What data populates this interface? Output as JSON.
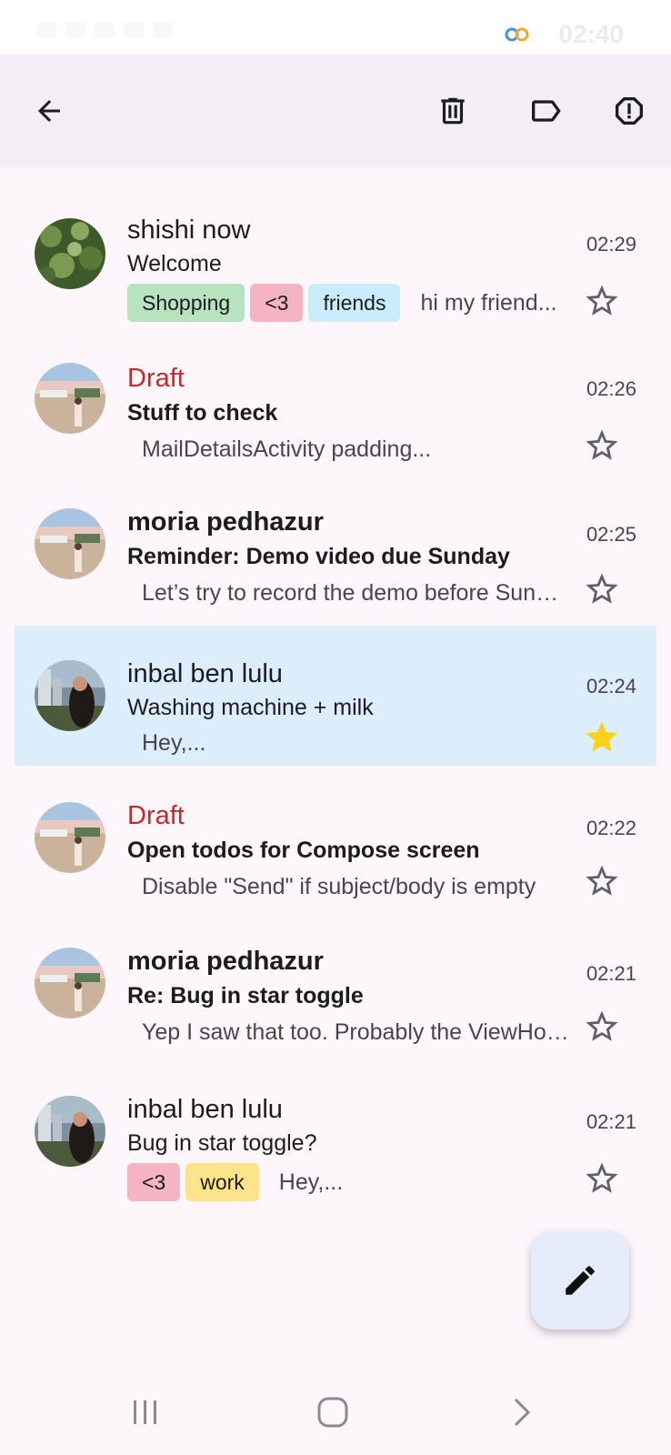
{
  "status_bar": {
    "time": "02:40"
  },
  "app_bar": {
    "back_icon": "arrow-back-icon",
    "delete_icon": "trash-icon",
    "label_icon": "label-icon",
    "report_icon": "report-icon"
  },
  "emails": [
    {
      "sender": "shishi now",
      "subject": "Welcome",
      "preview": "hi my friend...",
      "time": "02:29",
      "starred": false,
      "draft": false,
      "unread": false,
      "tags": [
        {
          "label": "Shopping",
          "color": "#b7e4be"
        },
        {
          "label": "<3",
          "color": "#f4b4c1"
        },
        {
          "label": "friends",
          "color": "#c8ecfa"
        }
      ]
    },
    {
      "sender": "Draft",
      "subject": "Stuff to check",
      "preview": "MailDetailsActivity padding...",
      "time": "02:26",
      "starred": false,
      "draft": true,
      "unread": true,
      "tags": []
    },
    {
      "sender": "moria pedhazur",
      "subject": "Reminder: Demo video due Sunday",
      "preview": "Let’s try to record the demo before Sunday",
      "time": "02:25",
      "starred": false,
      "draft": false,
      "unread": true,
      "tags": []
    },
    {
      "sender": "inbal ben lulu",
      "subject": "Washing machine + milk",
      "preview": "Hey,...",
      "time": "02:24",
      "starred": true,
      "draft": false,
      "unread": false,
      "selected": true,
      "tags": []
    },
    {
      "sender": "Draft",
      "subject": "Open todos for Compose screen",
      "preview": "Disable \"Send\" if subject/body is empty",
      "time": "02:22",
      "starred": false,
      "draft": true,
      "unread": true,
      "tags": []
    },
    {
      "sender": "moria pedhazur",
      "subject": "Re: Bug in star toggle",
      "preview": "Yep I saw that too. Probably the ViewHolder",
      "time": "02:21",
      "starred": false,
      "draft": false,
      "unread": true,
      "tags": []
    },
    {
      "sender": "inbal ben lulu",
      "subject": "Bug in star toggle?",
      "preview": "Hey,...",
      "time": "02:21",
      "starred": false,
      "draft": false,
      "unread": false,
      "tags": [
        {
          "label": "<3",
          "color": "#f4b4c1"
        },
        {
          "label": "work",
          "color": "#fde38a"
        }
      ]
    }
  ],
  "colors": {
    "draft": "#c62828",
    "star_filled": "#fbd21a",
    "selected_row": "#dcedfb",
    "app_bar": "#f3eef6"
  },
  "fab": {
    "icon": "pencil-icon"
  },
  "nav_bar": {
    "recents_icon": "recents-icon",
    "home_icon": "home-icon",
    "back_icon": "nav-back-icon"
  }
}
